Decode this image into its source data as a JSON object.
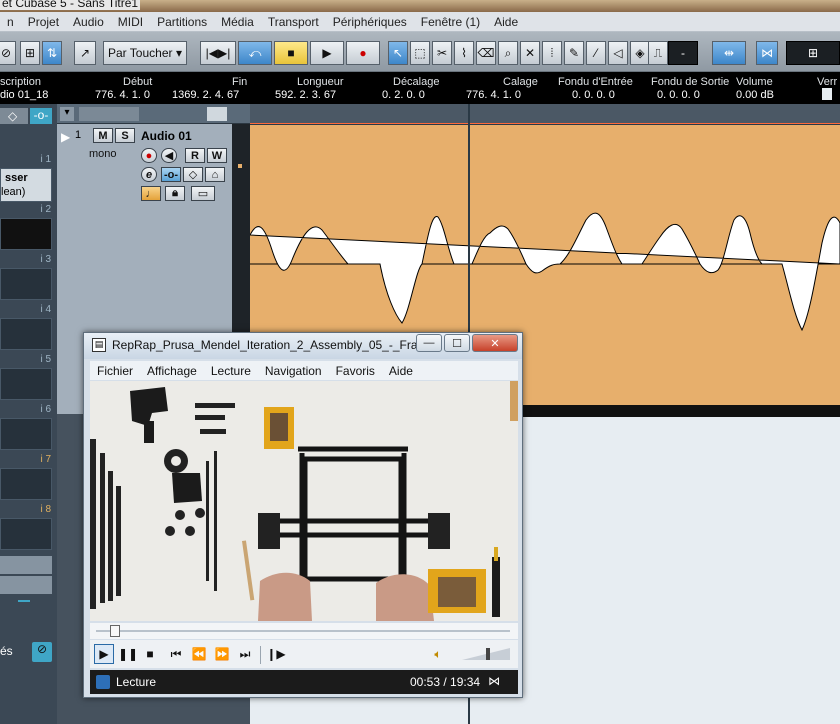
{
  "window": {
    "title": "et Cubase 5 - Sans Titre1"
  },
  "menu": [
    "n",
    "Projet",
    "Audio",
    "MIDI",
    "Partitions",
    "Média",
    "Transport",
    "Périphériques",
    "Fenêtre (1)",
    "Aide"
  ],
  "toolbar": {
    "mode_select": "Par Toucher",
    "counter": "-"
  },
  "infoline": {
    "headers": {
      "description": "scription",
      "debut": "Début",
      "fin": "Fin",
      "longueur": "Longueur",
      "decalage": "Décalage",
      "calage": "Calage",
      "fondu_entree": "Fondu d'Entrée",
      "fondu_sortie": "Fondu de Sortie",
      "volume": "Volume",
      "verr": "Verr"
    },
    "values": {
      "description": "dio 01_18",
      "debut": "776. 4. 1.   0",
      "fin": "1369. 2. 4. 67",
      "longueur": "592. 2. 3. 67",
      "decalage": "0. 2. 0.   0",
      "calage": "776. 4. 1.   0",
      "fondu_entree": "0. 0. 0.   0",
      "fondu_sortie": "0. 0. 0.   0",
      "volume": "0.00 dB"
    }
  },
  "inspector": {
    "insert_name": "sser",
    "insert_sub": "lean)",
    "slot_numbers": [
      "i 1",
      "i 2",
      "i 3",
      "i 4",
      "i 5",
      "i 6",
      "i 7",
      "i 8"
    ],
    "bottom_label": "és"
  },
  "track": {
    "number": "1",
    "name": "Audio 01",
    "channel": "mono",
    "mute": "M",
    "solo": "S",
    "read": "R",
    "write": "W",
    "edit": "e"
  },
  "colors": {
    "event": "#e7af6c",
    "toolbar_active": "#3d86c9",
    "cursor": "#2a3945"
  },
  "player": {
    "title": "RepRap_Prusa_Mendel_Iteration_2_Assembly_05_-_Fra...",
    "menu": [
      "Fichier",
      "Affichage",
      "Lecture",
      "Navigation",
      "Favoris",
      "Aide"
    ],
    "status": "Lecture",
    "time": "00:53 / 19:34",
    "progress": 0.045,
    "volume_level": 0.55
  }
}
